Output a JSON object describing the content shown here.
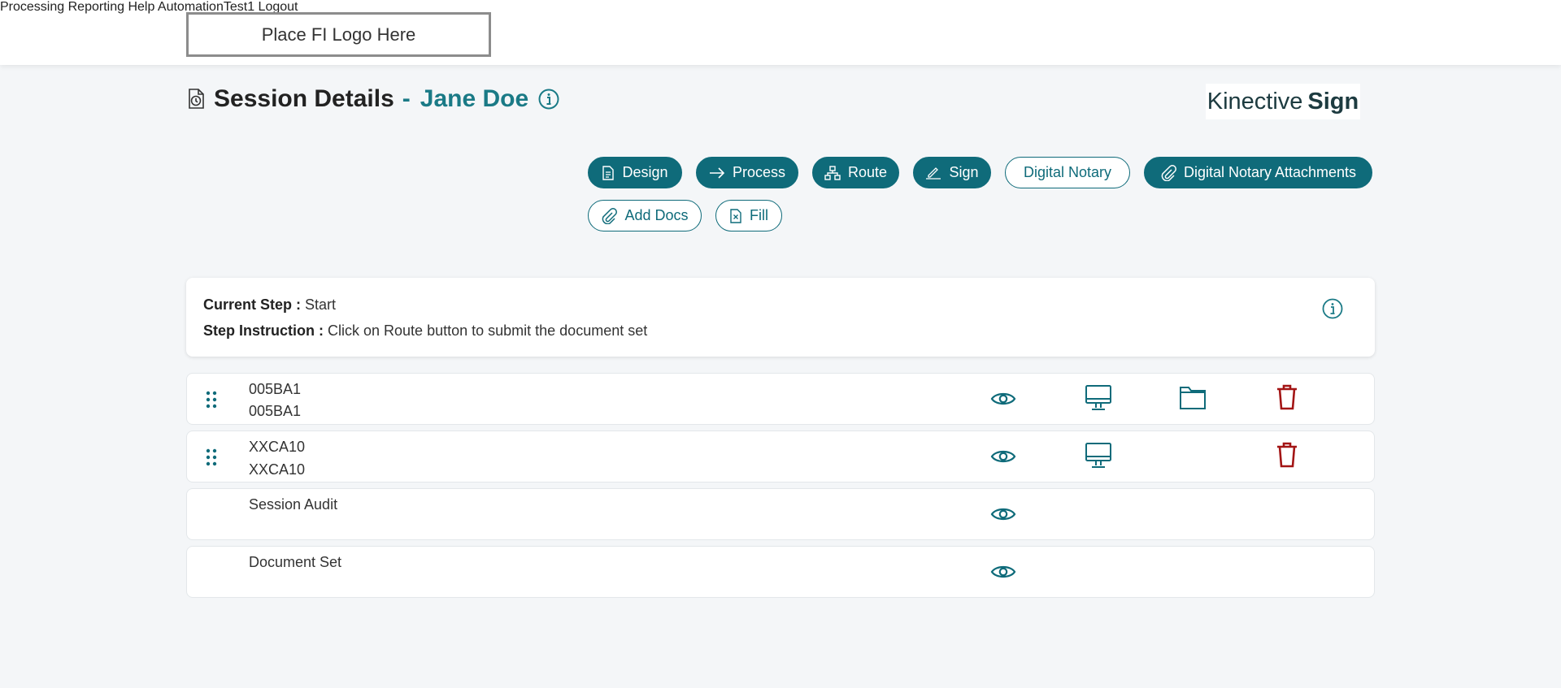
{
  "header": {
    "logo_text": "Place FI Logo Here",
    "nav": [
      "Processing",
      "Reporting",
      "Help",
      "AutomationTest1",
      "Logout"
    ]
  },
  "page": {
    "title": "Session Details",
    "separator": "-",
    "customer_name": "Jane Doe",
    "brand_light": "Kinective",
    "brand_bold": "Sign"
  },
  "actions": {
    "design": "Design",
    "process": "Process",
    "route": "Route",
    "sign": "Sign",
    "digital_notary": "Digital Notary",
    "digital_notary_attachments": "Digital Notary Attachments",
    "add_docs": "Add Docs",
    "fill": "Fill"
  },
  "step": {
    "current_label": "Current Step :",
    "current_value": "Start",
    "instruction_label": "Step Instruction :",
    "instruction_value": "Click on Route button to submit the document set"
  },
  "documents": [
    {
      "line1": "005BA1",
      "line2": "005BA1"
    },
    {
      "line1": "XXCA10",
      "line2": "XXCA10"
    },
    {
      "line1": "Session Audit"
    },
    {
      "line1": "Document Set"
    }
  ],
  "colors": {
    "accent": "#0f6b7a",
    "title_accent": "#1a7a86",
    "delete": "#a31515",
    "background": "#f4f6f8"
  },
  "icons": [
    "history-document-icon",
    "info-icon",
    "document-icon",
    "arrow-right-icon",
    "sitemap-icon",
    "signature-icon",
    "paperclip-icon",
    "fill-document-icon",
    "drag-handle-icon",
    "eye-icon",
    "monitor-icon",
    "folder-icon",
    "trash-icon"
  ]
}
